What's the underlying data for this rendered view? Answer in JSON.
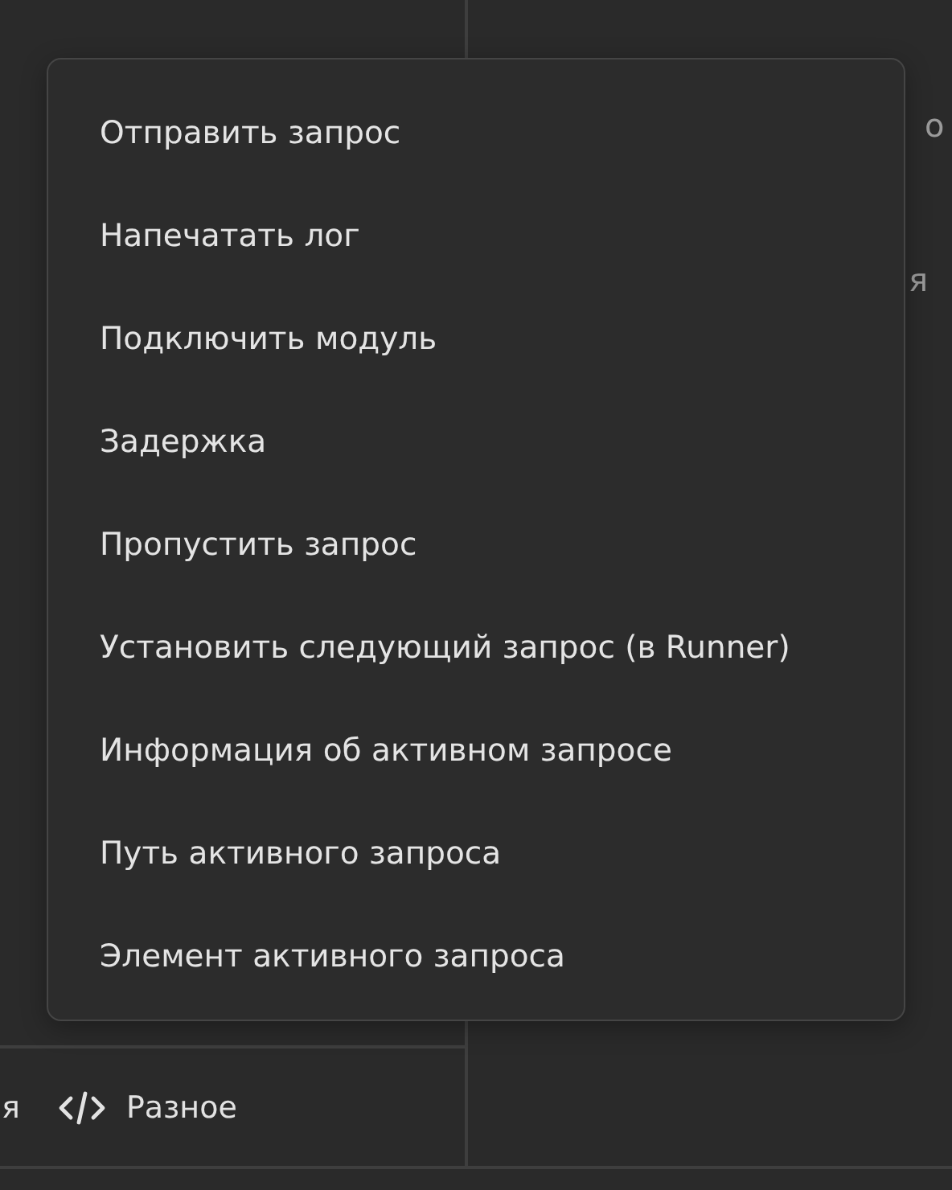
{
  "right_panel": {
    "lines": [
      "о",
      "я"
    ]
  },
  "bottom_tabs": [
    {
      "label": "я",
      "kind": "text"
    },
    {
      "label": "Разное",
      "kind": "code"
    }
  ],
  "context_menu": {
    "items": [
      "Отправить запрос",
      "Напечатать лог",
      "Подключить модуль",
      "Задержка",
      "Пропустить запрос",
      "Установить следующий запрос (в Runner)",
      "Информация об активном запросе",
      "Путь активного запроса",
      "Элемент активного запроса"
    ]
  }
}
